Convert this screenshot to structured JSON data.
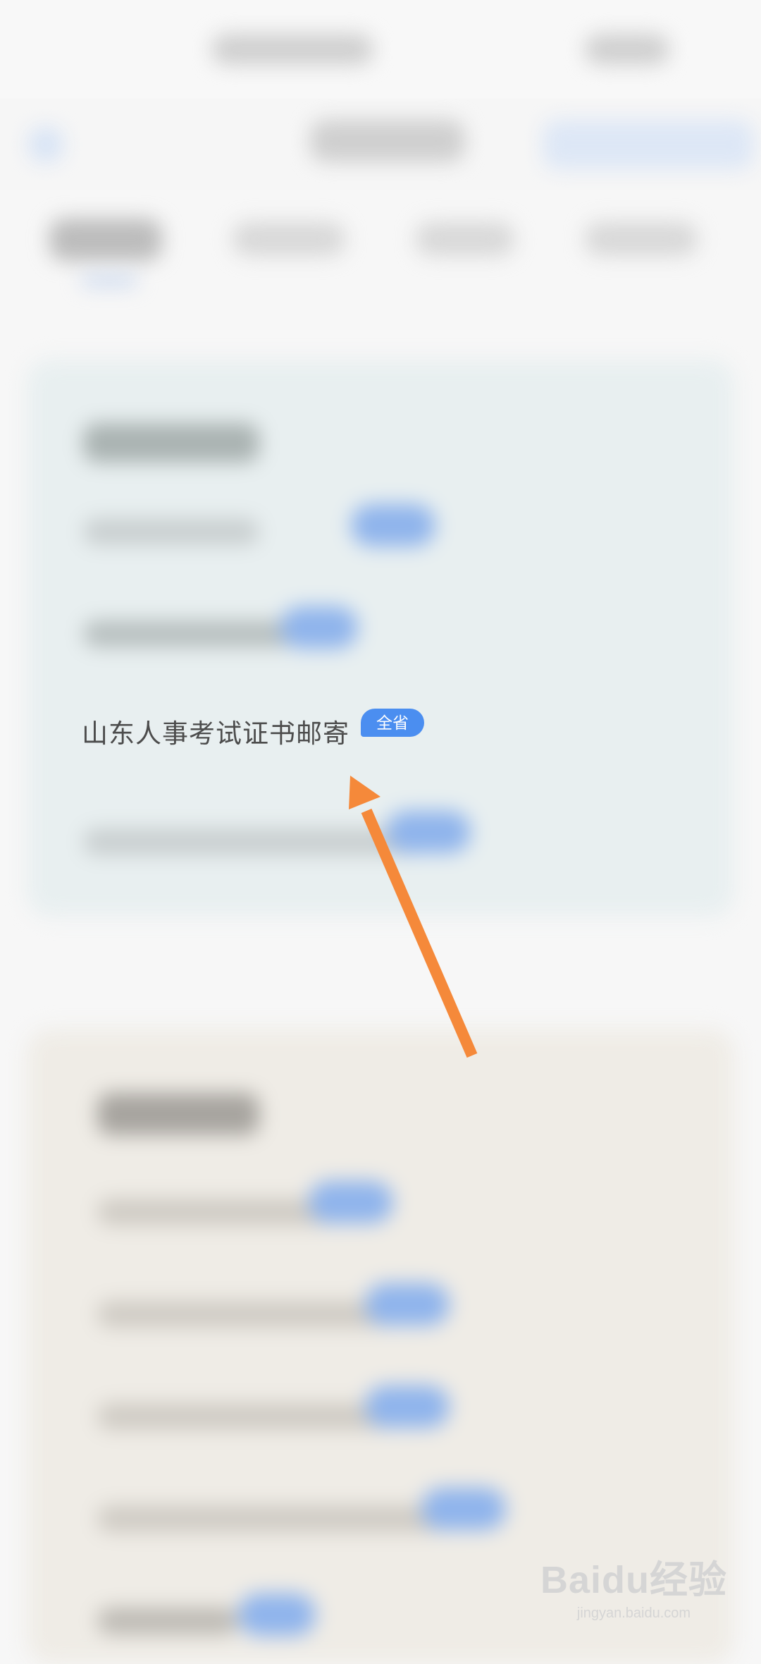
{
  "list": {
    "visible_item": {
      "title": "山东人事考试证书邮寄",
      "badge": "全省"
    }
  },
  "annotation": {
    "arrow_color": "#f5893a"
  },
  "watermark": {
    "logo": "Baidu经验",
    "url": "jingyan.baidu.com"
  },
  "colors": {
    "accent_blue": "#4b8ef0",
    "card_bg_1": "#e8eff0",
    "card_bg_2": "#efece6"
  }
}
